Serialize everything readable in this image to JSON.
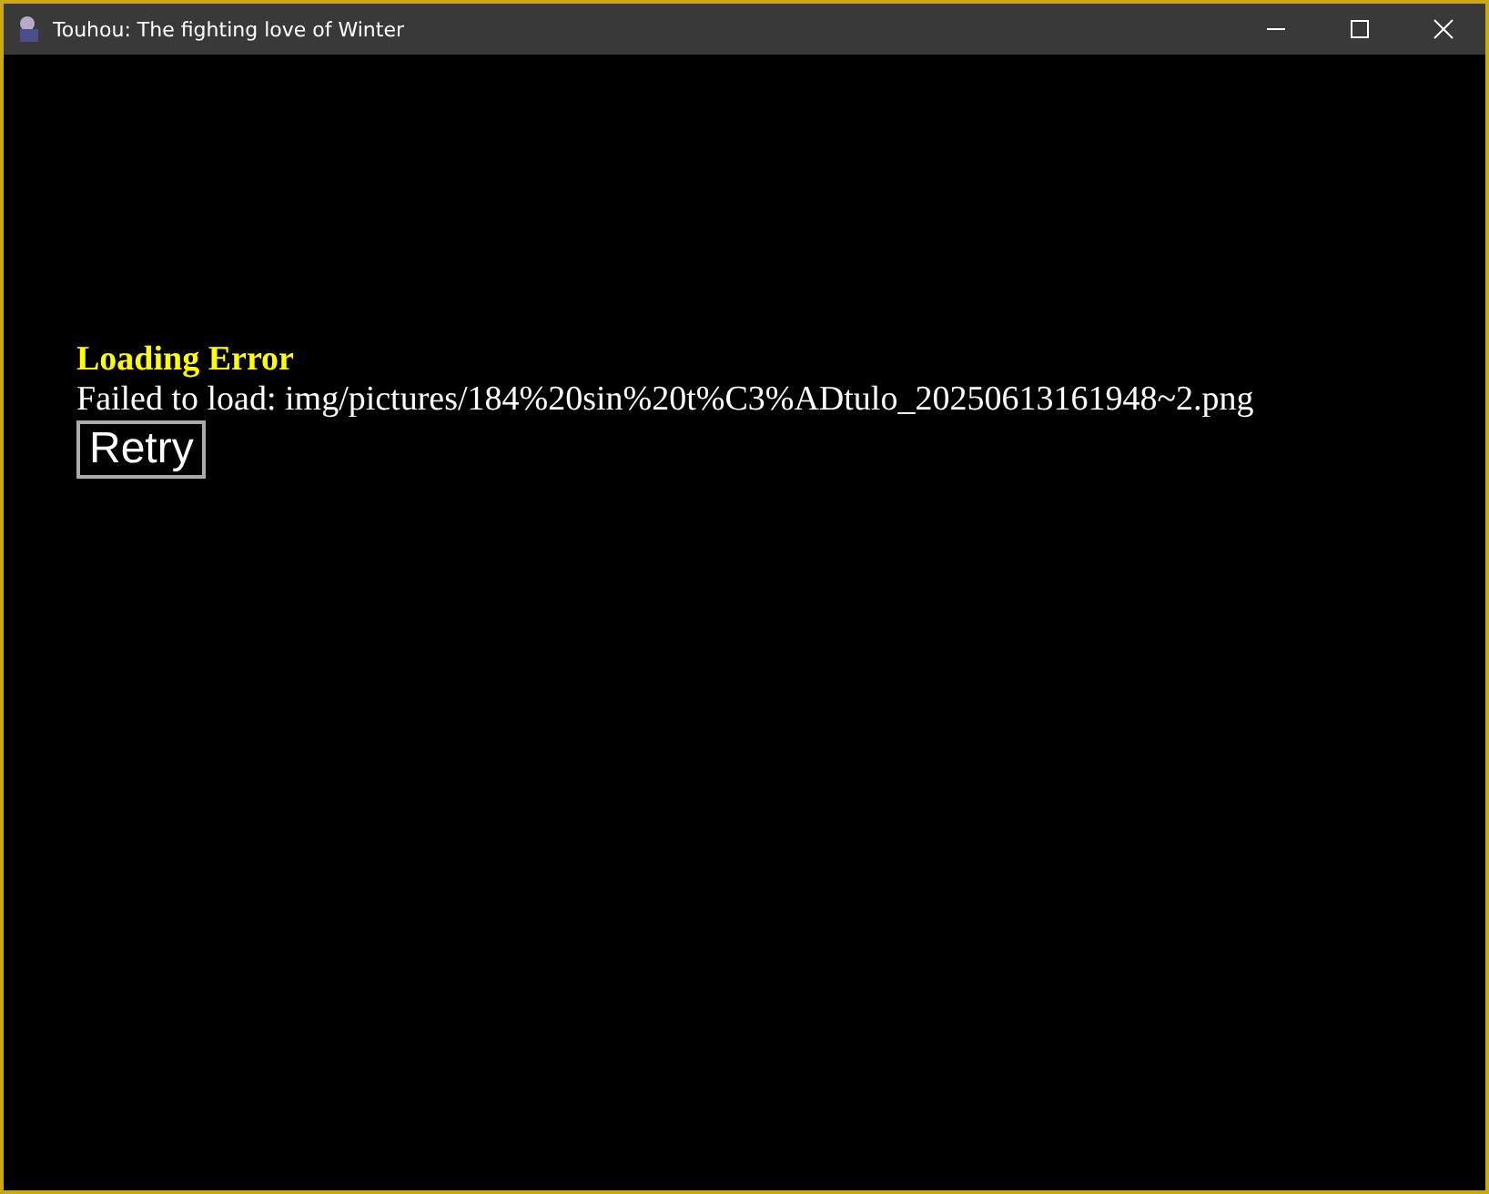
{
  "window": {
    "title": "Touhou: The fighting love of Winter"
  },
  "error": {
    "title": "Loading Error",
    "message": "Failed to load: img/pictures/184%20sin%20t%C3%ADtulo_20250613161948~2.png",
    "button": "Retry"
  }
}
